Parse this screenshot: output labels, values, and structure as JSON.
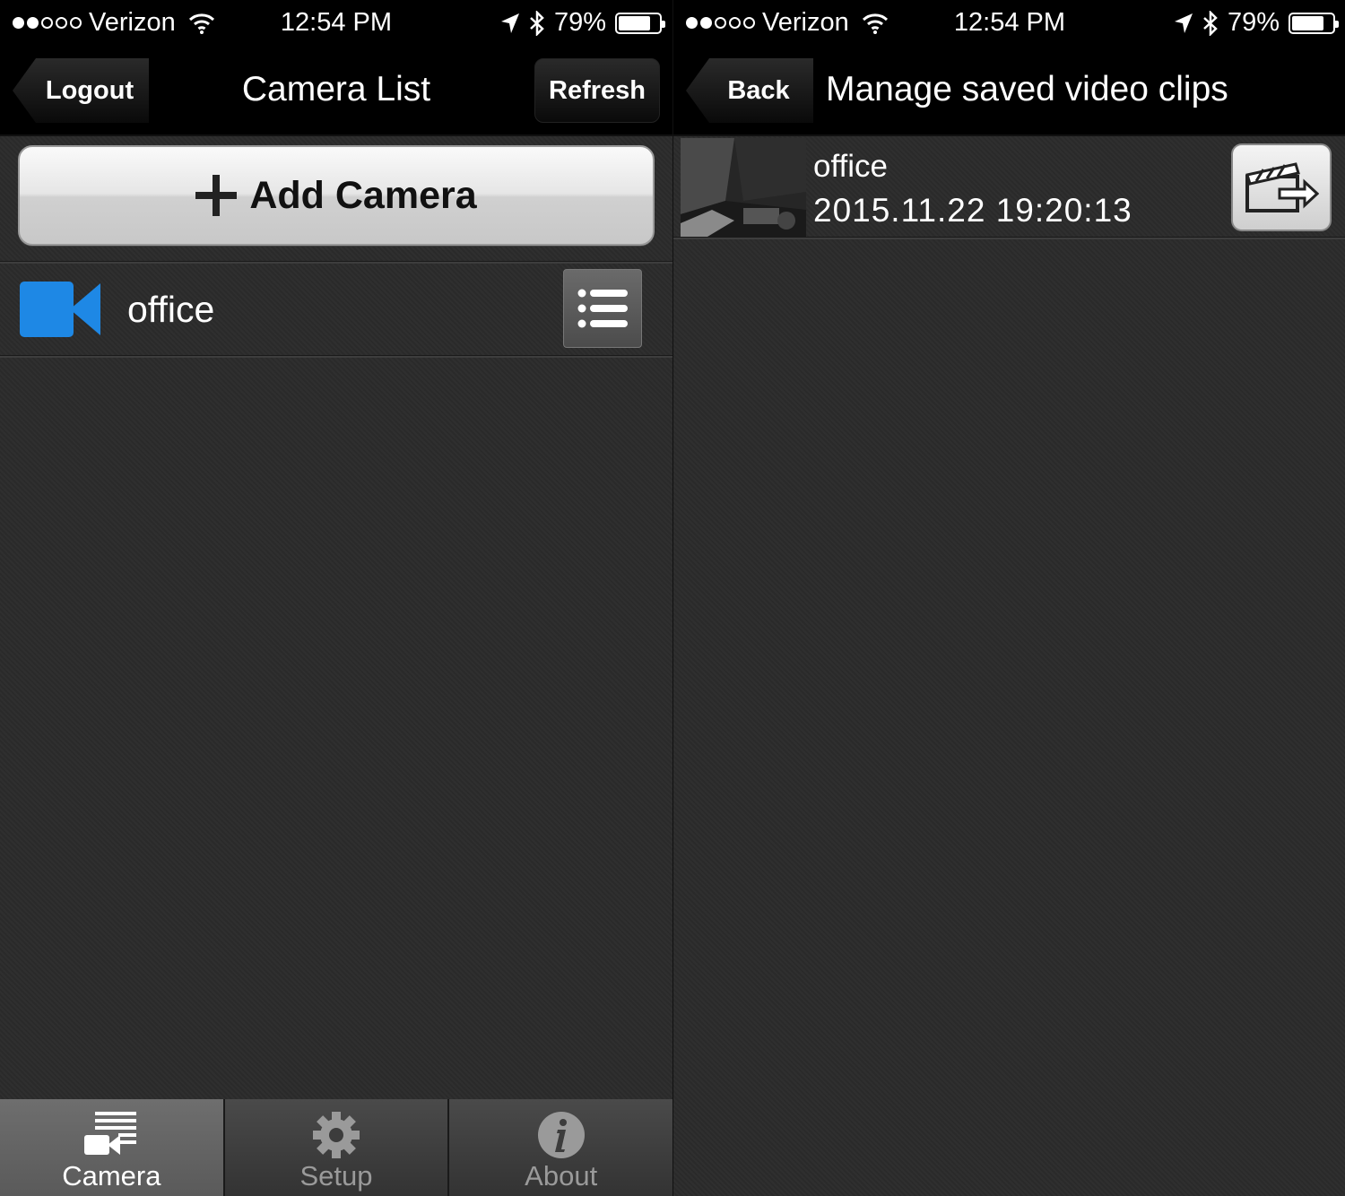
{
  "left_screen": {
    "status_bar": {
      "carrier": "Verizon",
      "time": "12:54 PM",
      "battery": "79%",
      "battery_level": 0.79
    },
    "nav": {
      "left_button": "Logout",
      "title": "Camera List",
      "right_button": "Refresh"
    },
    "add_camera_label": "Add Camera",
    "cameras": [
      {
        "name": "office",
        "icon": "video-camera-icon",
        "icon_color": "#1e88e5"
      }
    ],
    "tabs": [
      {
        "label": "Camera",
        "icon": "camera-list-icon",
        "active": true
      },
      {
        "label": "Setup",
        "icon": "gear-icon",
        "active": false
      },
      {
        "label": "About",
        "icon": "info-icon",
        "active": false
      }
    ]
  },
  "right_screen": {
    "status_bar": {
      "carrier": "Verizon",
      "time": "12:54 PM",
      "battery": "79%",
      "battery_level": 0.79
    },
    "nav": {
      "left_button": "Back",
      "title": "Manage saved video clips"
    },
    "clips": [
      {
        "title": "office",
        "timestamp": "2015.11.22 19:20:13",
        "action_icon": "export-clip-icon"
      }
    ]
  }
}
